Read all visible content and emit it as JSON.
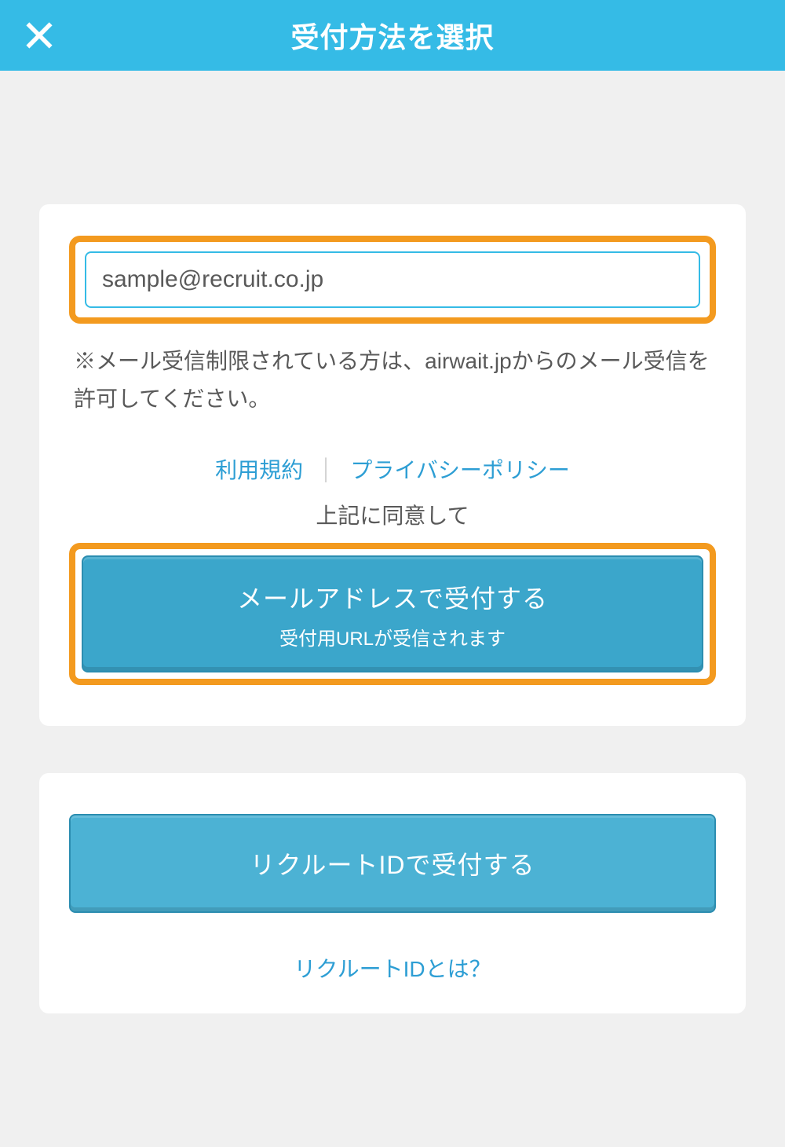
{
  "header": {
    "title": "受付方法を選択"
  },
  "email_section": {
    "value": "sample@recruit.co.jp",
    "note": "※メール受信制限されている方は、airwait.jpからのメール受信を許可してください。",
    "terms_link": "利用規約",
    "privacy_link": "プライバシーポリシー",
    "agree_text": "上記に同意して",
    "submit_title": "メールアドレスで受付する",
    "submit_sub": "受付用URLが受信されます"
  },
  "recruit_section": {
    "button_label": "リクルートIDで受付する",
    "help_link": "リクルートIDとは？"
  }
}
